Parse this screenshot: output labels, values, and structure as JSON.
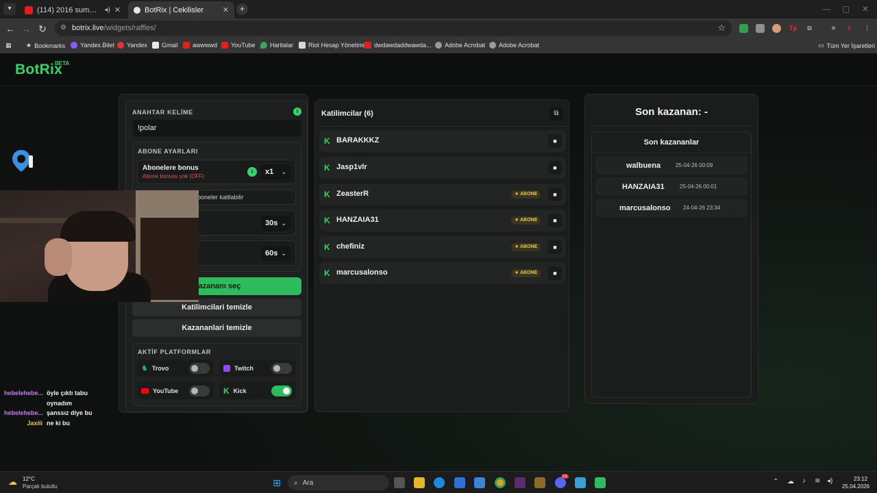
{
  "browser": {
    "tabs": [
      {
        "label": "(114) 2016 summer vibes -",
        "favicon": "youtube-icon",
        "active": false
      },
      {
        "label": "BotRix | Cekilisler",
        "favicon": "botrix-icon",
        "active": true
      }
    ],
    "url_host": "botrix.live",
    "url_path": "/widgets/raffles/",
    "bookmarks": [
      {
        "label": "Bookmarks",
        "icon": "star-icon"
      },
      {
        "label": "Yandex.Bilet",
        "icon": "yandex-icon"
      },
      {
        "label": "Yandex",
        "icon": "yandex-icon"
      },
      {
        "label": "Gmail",
        "icon": "gmail-icon"
      },
      {
        "label": "awwwwd",
        "icon": "youtube-icon"
      },
      {
        "label": "YouTube",
        "icon": "youtube-icon"
      },
      {
        "label": "Haritalar",
        "icon": "maps-icon"
      },
      {
        "label": "Riot Hesap Yönetimi",
        "icon": "riot-icon"
      },
      {
        "label": "dwdawdaddwawda...",
        "icon": "youtube-icon"
      },
      {
        "label": "Adobe Acrobat",
        "icon": "globe-icon"
      },
      {
        "label": "Adobe Acrobat",
        "icon": "globe-icon"
      }
    ],
    "all_bookmarks": "Tüm Yer İşaretleri"
  },
  "app": {
    "logo": "BotRix",
    "logo_badge": "BETA",
    "accent": "#35d36b"
  },
  "settings": {
    "keyword_label": "ANAHTAR KELİME",
    "keyword_value": "!polar",
    "sub_settings_label": "ABONE AYARLARI",
    "sub_bonus_title": "Abonelere bonus",
    "sub_bonus_subtitle": "Abone bonusu yok (OFF)",
    "sub_bonus_multiplier": "x1",
    "subs_only_text": "boneler katilabilir",
    "duration_1": "30s",
    "duration_2": "60s",
    "pick_winner": "Kazananı seç",
    "clear_participants": "Katilimcilari temizle",
    "clear_winners": "Kazananlari temizle",
    "platforms_label": "AKTİF PLATFORMLAR",
    "platforms": [
      {
        "name": "Trovo",
        "enabled": false,
        "color": "#1db88a"
      },
      {
        "name": "Twitch",
        "enabled": false,
        "color": "#9146ff"
      },
      {
        "name": "YouTube",
        "enabled": false,
        "color": "#ff0000"
      },
      {
        "name": "Kick",
        "enabled": true,
        "color": "#35d36b"
      }
    ]
  },
  "participants": {
    "title": "Katilimcilar (6)",
    "badge_label": "ABONE",
    "list": [
      {
        "name": "BARAKKKZ",
        "subscriber": false
      },
      {
        "name": "Jasp1vlr",
        "subscriber": false
      },
      {
        "name": "ZeasterR",
        "subscriber": true
      },
      {
        "name": "HANZAIA31",
        "subscriber": true
      },
      {
        "name": "chefiniz",
        "subscriber": true
      },
      {
        "name": "marcusalonso",
        "subscriber": true
      }
    ]
  },
  "winners": {
    "last_winner_title": "Son kazanan: -",
    "recent_title": "Son kazananlar",
    "list": [
      {
        "name": "walbuena",
        "date": "25-04-26 00:09"
      },
      {
        "name": "HANZAIA31",
        "date": "25-04-26 00:01"
      },
      {
        "name": "marcusalonso",
        "date": "24-04-26 23:34"
      }
    ]
  },
  "chat": [
    {
      "user": "hebelehebe...",
      "user_color": "#c57cf0",
      "lines": [
        "öyle çıktı tabu",
        "oynadım"
      ]
    },
    {
      "user": "hebelehebe...",
      "user_color": "#c57cf0",
      "lines": [
        "şanssız diye bu"
      ]
    },
    {
      "user": "Jaxiii",
      "user_color": "#e6c44d",
      "lines": [
        "ne ki bu"
      ]
    }
  ],
  "taskbar": {
    "weather_temp": "12°C",
    "weather_desc": "Parçalı bulutlu",
    "search_placeholder": "Ara",
    "time": "23:12",
    "date": "25.04.2026",
    "discord_badge": "23"
  }
}
